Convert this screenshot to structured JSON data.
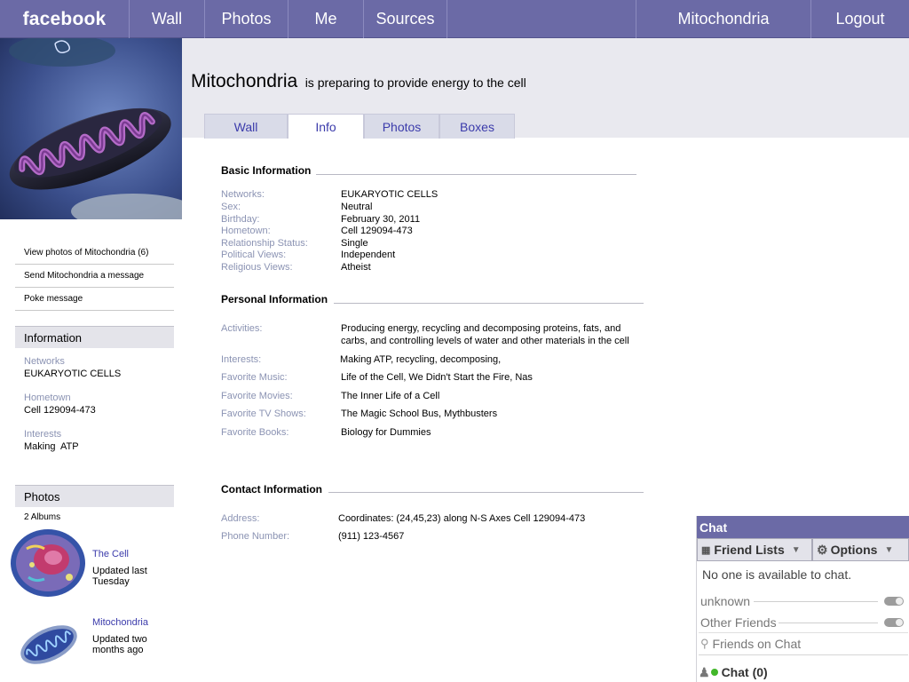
{
  "topnav": {
    "brand": "facebook",
    "wall": "Wall",
    "photos": "Photos",
    "me": "Me",
    "sources": "Sources",
    "profile": "Mitochondria",
    "logout": "Logout"
  },
  "header": {
    "name": "Mitochondria",
    "status": "is preparing to provide energy to the cell"
  },
  "tabs": [
    "Wall",
    "Info",
    "Photos",
    "Boxes"
  ],
  "active_tab": "Info",
  "sidebar": {
    "links": [
      "View photos of Mitochondria (6)",
      "Send Mitochondria a message",
      "Poke message"
    ],
    "information": {
      "heading": "Information",
      "networks_label": "Networks",
      "networks_value": "EUKARYOTIC CELLS",
      "hometown_label": "Hometown",
      "hometown_value": "Cell 129094-473",
      "interests_label": "Interests",
      "interests_value": "Making  ATP"
    },
    "photos": {
      "heading": "Photos",
      "albums_count": "2 Albums",
      "albums": [
        {
          "title": "The Cell",
          "updated": "Updated last Tuesday"
        },
        {
          "title": "Mitochondria",
          "updated": "Updated two months ago"
        }
      ]
    }
  },
  "info": {
    "basic": {
      "title": "Basic Information",
      "fields": [
        {
          "label": "Networks:",
          "value": "EUKARYOTIC CELLS"
        },
        {
          "label": "Sex:",
          "value": "Neutral"
        },
        {
          "label": "Birthday:",
          "value": "February 30, 2011"
        },
        {
          "label": "Hometown:",
          "value": "Cell 129094-473"
        },
        {
          "label": "Relationship Status:",
          "value": "Single"
        },
        {
          "label": "Political Views:",
          "value": "Independent"
        },
        {
          "label": "Religious Views:",
          "value": "Atheist"
        }
      ]
    },
    "personal": {
      "title": "Personal Information",
      "fields": [
        {
          "label": "Activities:",
          "value": "Producing energy, recycling and decomposing proteins, fats, and carbs, and controlling levels of water and other materials in the cell"
        },
        {
          "label": "Interests:",
          "value": "Making ATP, recycling, decomposing,"
        },
        {
          "label": "Favorite Music:",
          "value": "Life of the Cell, We Didn't Start the Fire, Nas"
        },
        {
          "label": "Favorite Movies:",
          "value": "The Inner Life of a Cell"
        },
        {
          "label": "Favorite TV Shows:",
          "value": "The Magic School Bus, Mythbusters"
        },
        {
          "label": "Favorite Books:",
          "value": "Biology for Dummies"
        }
      ]
    },
    "contact": {
      "title": "Contact Information",
      "fields": [
        {
          "label": "Address:",
          "value": "Coordinates: (24,45,23) along N-S Axes Cell 129094-473"
        },
        {
          "label": "Phone Number:",
          "value": "(911) 123-4567"
        }
      ]
    }
  },
  "chat": {
    "title": "Chat",
    "friend_lists": "Friend Lists",
    "options": "Options",
    "empty_message": "No one is available to chat.",
    "groups": [
      "unknown",
      "Other Friends"
    ],
    "search_placeholder": "Friends on Chat",
    "footer": "Chat (0)"
  }
}
